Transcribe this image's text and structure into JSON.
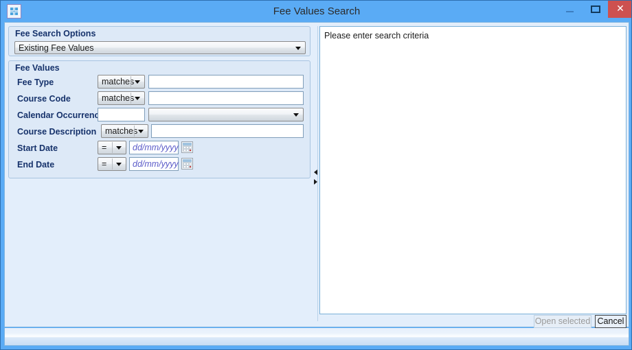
{
  "window": {
    "title": "Fee Values Search",
    "icon": "app-grid-icon",
    "controls": {
      "minimize": "minimize-icon",
      "maximize": "maximize-icon",
      "close": "✕"
    }
  },
  "search_options_group": {
    "title": "Fee Search Options",
    "mode_select": {
      "value": "Existing Fee Values",
      "options": [
        "Existing Fee Values"
      ]
    }
  },
  "fee_values_group": {
    "title": "Fee Values",
    "rows": [
      {
        "label": "Fee Type",
        "operator": "matches",
        "value": "",
        "type": "text"
      },
      {
        "label": "Course Code",
        "operator": "matches",
        "value": "",
        "type": "text"
      },
      {
        "label": "Calendar Occurrence",
        "operator": "",
        "value": "",
        "type": "combo"
      },
      {
        "label": "Course Description",
        "operator": "matches",
        "value": "",
        "type": "text"
      },
      {
        "label": "Start Date",
        "operator": "=",
        "value": "",
        "placeholder": "dd/mm/yyyy",
        "type": "date"
      },
      {
        "label": "End Date",
        "operator": "=",
        "value": "",
        "placeholder": "dd/mm/yyyy",
        "type": "date"
      }
    ]
  },
  "results_panel": {
    "message": "Please enter search criteria"
  },
  "footer": {
    "open_selected_label": "Open selected",
    "cancel_label": "Cancel"
  },
  "colors": {
    "titlebar": "#5aabf5",
    "close_button": "#cd5150",
    "client_background": "#e3eefb",
    "group_background": "#dde9f7",
    "label_text": "#16326b",
    "placeholder_text": "#5a5ac8"
  }
}
